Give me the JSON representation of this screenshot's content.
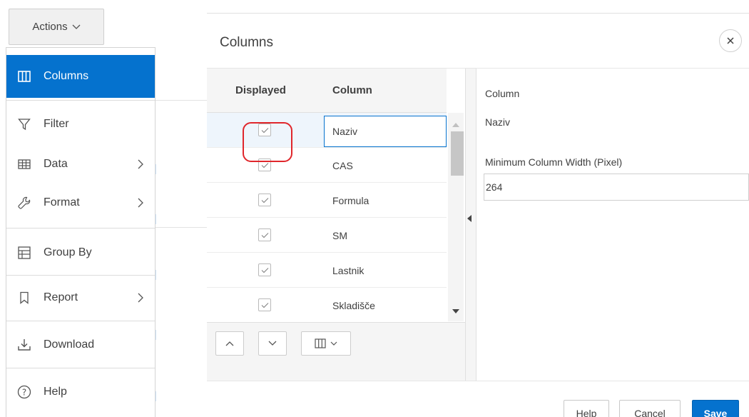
{
  "actions_button": {
    "label": "Actions",
    "icon": "chevron-down-icon"
  },
  "actions_menu": {
    "items": [
      {
        "label": "Columns",
        "icon": "columns-icon",
        "active": true,
        "submenu": false
      },
      {
        "label": "Filter",
        "icon": "filter-icon",
        "active": false,
        "submenu": false
      },
      {
        "label": "Data",
        "icon": "table-data-icon",
        "active": false,
        "submenu": true
      },
      {
        "label": "Format",
        "icon": "wrench-icon",
        "active": false,
        "submenu": true
      },
      {
        "label": "Group By",
        "icon": "group-by-icon",
        "active": false,
        "submenu": false
      },
      {
        "label": "Report",
        "icon": "bookmark-icon",
        "active": false,
        "submenu": true
      },
      {
        "label": "Download",
        "icon": "download-icon",
        "active": false,
        "submenu": false
      },
      {
        "label": "Help",
        "icon": "help-circle-icon",
        "active": false,
        "submenu": false
      }
    ]
  },
  "dialog": {
    "title": "Columns",
    "close_icon": "close-icon",
    "grid": {
      "headers": {
        "displayed": "Displayed",
        "column": "Column"
      },
      "rows": [
        {
          "name": "Naziv",
          "displayed": true,
          "selected": true
        },
        {
          "name": "CAS",
          "displayed": true,
          "selected": false
        },
        {
          "name": "Formula",
          "displayed": true,
          "selected": false
        },
        {
          "name": "SM",
          "displayed": true,
          "selected": false
        },
        {
          "name": "Lastnik",
          "displayed": true,
          "selected": false
        },
        {
          "name": "Skladišče",
          "displayed": true,
          "selected": false
        }
      ],
      "toolbar": {
        "move_up_icon": "chevron-up-icon",
        "move_down_icon": "chevron-down-icon",
        "columns_menu_icon": "columns-icon"
      }
    },
    "detail": {
      "column_label": "Column",
      "column_value": "Naziv",
      "min_width_label": "Minimum Column Width (Pixel)",
      "min_width_value": "264"
    },
    "buttons": {
      "help": "Help",
      "cancel": "Cancel",
      "save": "Save"
    }
  },
  "colors": {
    "accent": "#0572ce",
    "highlight": "#e0262b"
  }
}
